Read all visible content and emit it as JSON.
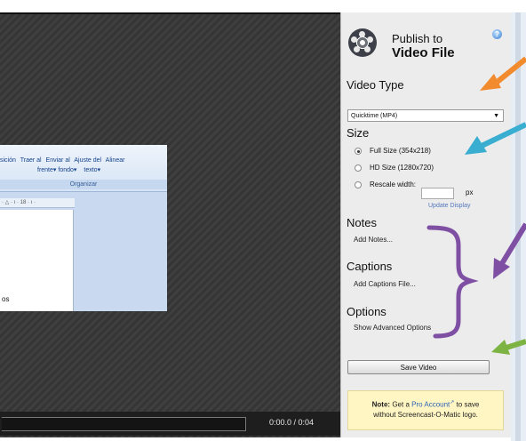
{
  "preview": {
    "ribbon_line1": [
      "sición",
      "Traer al",
      "Enviar al",
      "Ajuste del",
      "Alinear"
    ],
    "ribbon_line2": [
      "frente",
      "fondo",
      "texto"
    ],
    "ribbon_group": "Organizar",
    "ruler_text": "· △ · ı · 18 · ı ·",
    "doc_text": "os",
    "timecode": "0:00.0 / 0:04"
  },
  "panel": {
    "title_line1": "Publish to",
    "title_line2": "Video File",
    "help_icon": "help-icon",
    "video_type": {
      "heading": "Video Type",
      "selected": "Quicktime (MP4)"
    },
    "size": {
      "heading": "Size",
      "options": [
        "Full Size (354x218)",
        "HD Size (1280x720)",
        "Rescale width:"
      ],
      "selected_index": 0,
      "unit": "px",
      "update_link": "Update Display"
    },
    "notes": {
      "heading": "Notes",
      "action": "Add Notes..."
    },
    "captions": {
      "heading": "Captions",
      "action": "Add Captions File..."
    },
    "options": {
      "heading": "Options",
      "action": "Show Advanced Options"
    },
    "save_button": "Save Video",
    "note": {
      "bold": "Note:",
      "pre": "Get a",
      "link": "Pro Account",
      "post": "to save",
      "line2": "without Screencast-O-Matic logo."
    }
  },
  "colors": {
    "orange_arrow": "#f28a2e",
    "teal_arrow": "#3aaed0",
    "purple_arrow": "#7e4fa3",
    "green_arrow": "#7cb342"
  }
}
